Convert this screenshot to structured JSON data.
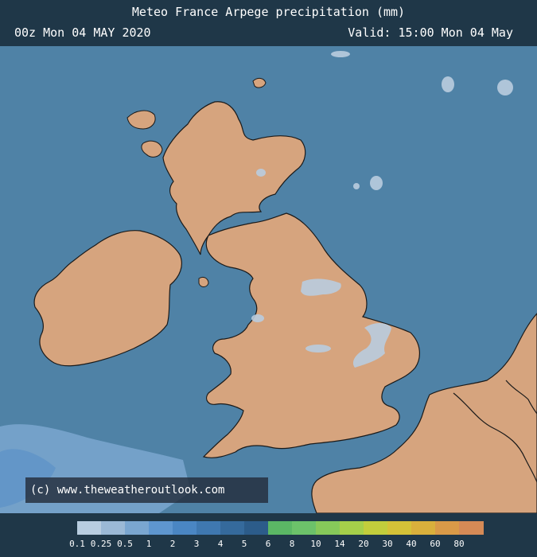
{
  "header": {
    "title": "Meteo France Arpege precipitation (mm)",
    "run": "00z Mon 04 MAY 2020",
    "valid": "Valid: 15:00 Mon 04 May"
  },
  "credit": "(c)  www.theweatheroutlook.com",
  "colors": {
    "sea": "#4f82a6",
    "land": "#d6a47e",
    "land_dark": "#c8906c",
    "light_precip": "#b9ccdf"
  },
  "legend": {
    "labels": [
      "0.1",
      "0.25",
      "0.5",
      "1",
      "2",
      "3",
      "4",
      "5",
      "6",
      "8",
      "10",
      "14",
      "20",
      "30",
      "40",
      "60",
      "80"
    ],
    "colors": [
      "#b8cde0",
      "#9bb9d6",
      "#7aa6d0",
      "#5e96cf",
      "#4a86c3",
      "#3f78b0",
      "#356a9c",
      "#2c5c8a",
      "#5bb765",
      "#6cc26a",
      "#86c95a",
      "#a5cf4a",
      "#c2cd3c",
      "#d4c238",
      "#d9b03c",
      "#d99a48",
      "#d58a56"
    ]
  }
}
